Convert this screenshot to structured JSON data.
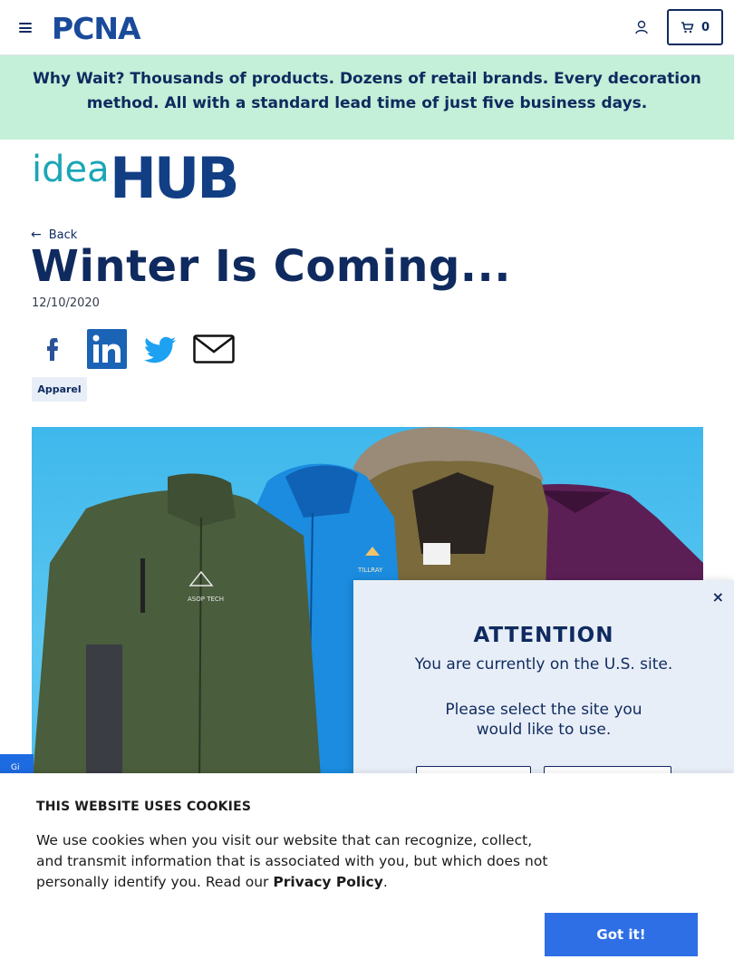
{
  "header": {
    "logo_text": "PCNA",
    "cart_count": "0"
  },
  "promo": {
    "lead": "Why Wait?",
    "text": "Thousands of products. Dozens of retail brands. Every decoration method. All with a standard lead time of just five business days."
  },
  "ideahub": {
    "part1": "idea",
    "part2": "HUB"
  },
  "article": {
    "back_label": "Back",
    "title": "Winter Is Coming...",
    "date": "12/10/2020",
    "tag": "Apparel",
    "share_icons": [
      "facebook-icon",
      "linkedin-icon",
      "twitter-icon",
      "email-icon"
    ]
  },
  "hero": {
    "brand_labels": [
      "ASOP TECH",
      "TILLRAY"
    ]
  },
  "feedback": {
    "label": "Gi"
  },
  "modal": {
    "title": "ATTENTION",
    "line1": "You are currently on the U.S. site.",
    "line2": "Please select the site you would like to use.",
    "close": "×"
  },
  "cookie": {
    "title": "THIS WEBSITE USES COOKIES",
    "text": "We use cookies when you visit our website that can recognize, collect, and transmit information that is associated with you, but which does not personally identify you. Read our ",
    "link": "Privacy Policy",
    "period": ".",
    "button": "Got it!"
  },
  "colors": {
    "navy": "#0f2a5f",
    "promo_bg": "#c4efd8",
    "teal": "#1aa6b7",
    "cookie_btn": "#2f6fe6"
  }
}
